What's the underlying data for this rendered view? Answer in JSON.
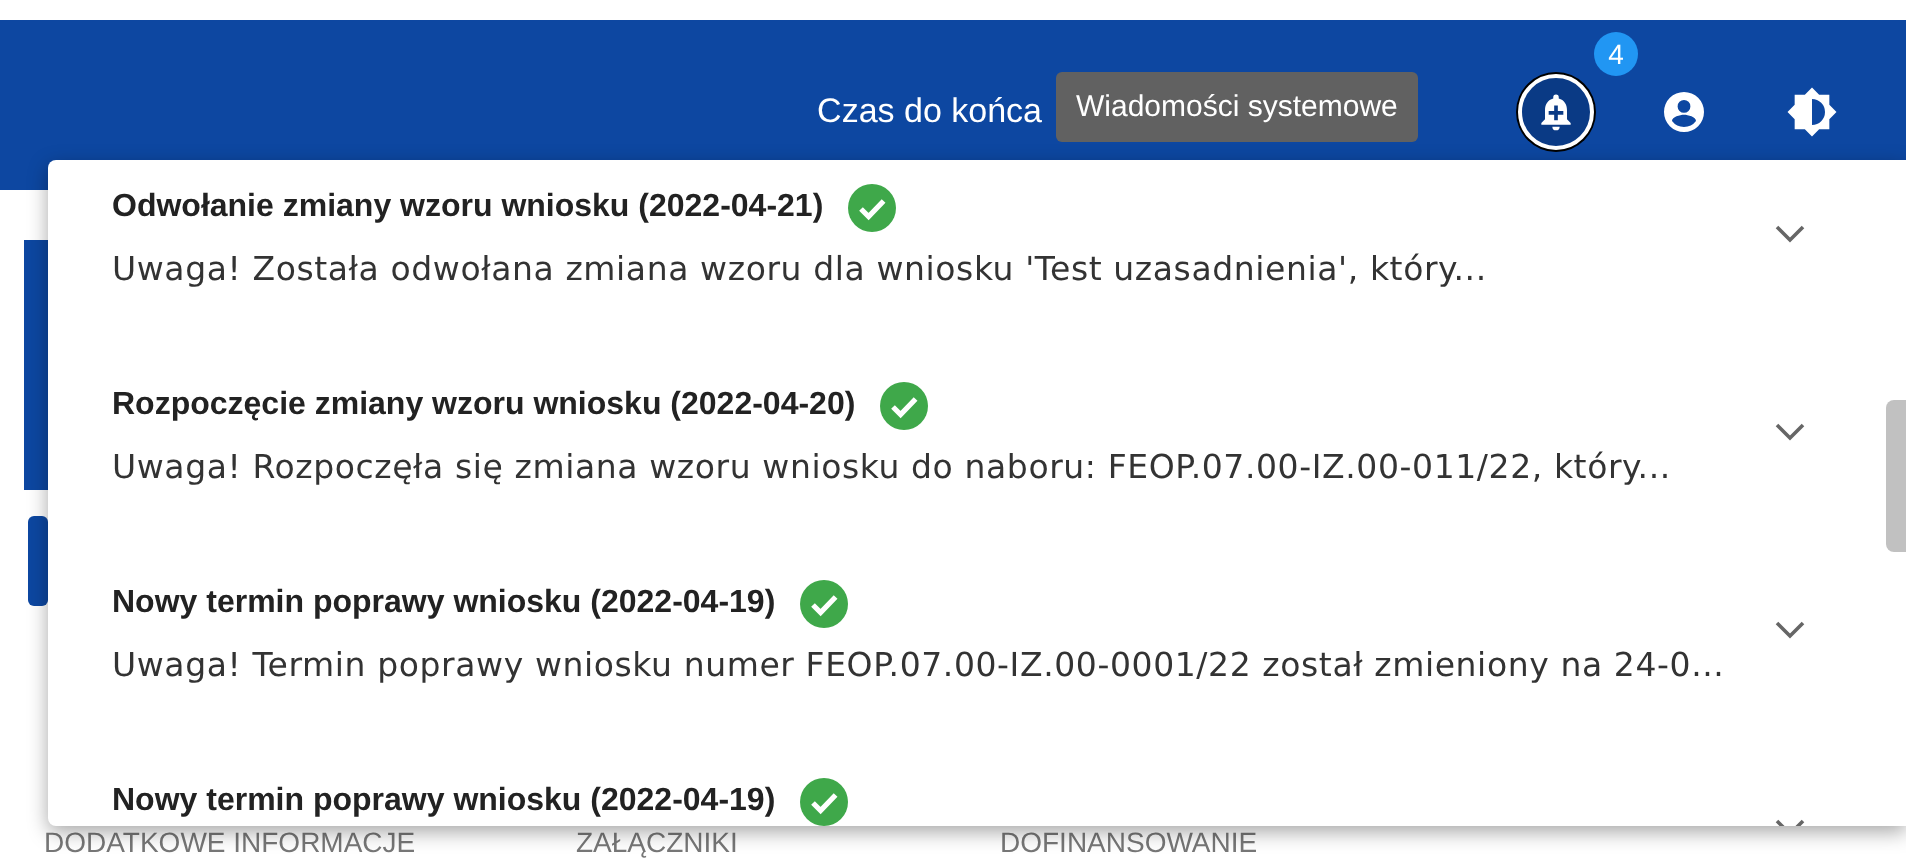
{
  "header": {
    "session_label": "Czas do końca",
    "tooltip": "Wiadomości systemowe",
    "notification_count": "4"
  },
  "notifications": [
    {
      "title": "Odwołanie zmiany wzoru wniosku (2022-04-21)",
      "read": true,
      "description": "Uwaga! Została odwołana zmiana wzoru dla wniosku 'Test uzasadnienia', który..."
    },
    {
      "title": "Rozpoczęcie zmiany wzoru wniosku (2022-04-20)",
      "read": true,
      "description": "Uwaga! Rozpoczęła się zmiana wzoru wniosku do naboru: FEOP.07.00-IZ.00-011/22, który..."
    },
    {
      "title": "Nowy termin poprawy wniosku (2022-04-19)",
      "read": true,
      "description": "Uwaga! Termin poprawy wniosku numer FEOP.07.00-IZ.00-0001/22 został zmieniony na 24-0..."
    },
    {
      "title": "Nowy termin poprawy wniosku (2022-04-19)",
      "read": true
    }
  ],
  "background_tabs": [
    "DODATKOWE INFORMACJE",
    "ZAŁĄCZNIKI",
    "DOFINANSOWANIE"
  ]
}
